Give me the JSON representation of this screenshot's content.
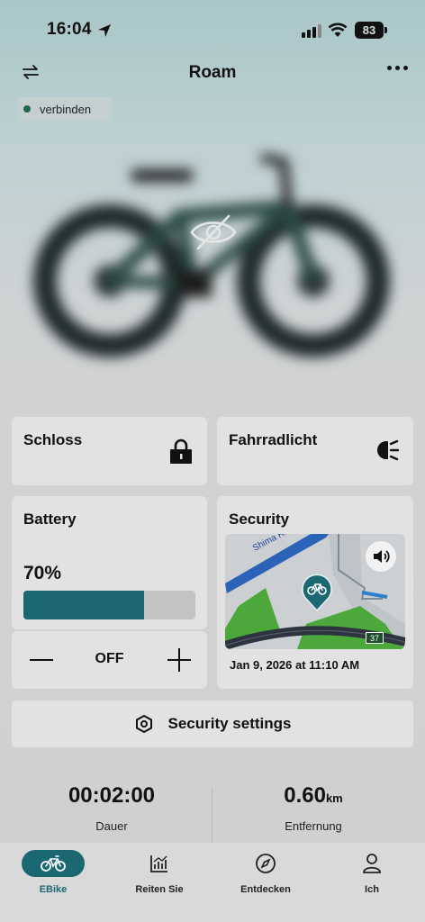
{
  "status_bar": {
    "time": "16:04",
    "battery_level": "83"
  },
  "header": {
    "title": "Roam"
  },
  "connection": {
    "label": "verbinden",
    "status_color": "#1e6a46"
  },
  "controls": {
    "lock": {
      "title": "Schloss",
      "icon": "lock-icon"
    },
    "light": {
      "title": "Fahrradlicht",
      "icon": "headlight-icon"
    }
  },
  "battery": {
    "title": "Battery",
    "percent_label": "70%",
    "level": 0.7,
    "fill_color": "#1b6872"
  },
  "assist": {
    "value": "OFF"
  },
  "security": {
    "title": "Security",
    "map_street": "Shima Rn",
    "map_badge": "37",
    "timestamp": "Jan 9, 2026 at 11:10 AM"
  },
  "security_settings": {
    "label": "Security settings"
  },
  "stats": {
    "duration": {
      "value": "00:02:00",
      "label": "Dauer"
    },
    "distance": {
      "value": "0.60",
      "unit": "km",
      "label": "Entfernung"
    }
  },
  "tabs": [
    {
      "label": "EBike",
      "icon": "bicycle-icon",
      "active": true
    },
    {
      "label": "Reiten Sie",
      "icon": "chart-icon",
      "active": false
    },
    {
      "label": "Entdecken",
      "icon": "compass-icon",
      "active": false
    },
    {
      "label": "Ich",
      "icon": "person-icon",
      "active": false
    }
  ],
  "colors": {
    "accent": "#1b6872",
    "card": "#e2e2e2"
  }
}
